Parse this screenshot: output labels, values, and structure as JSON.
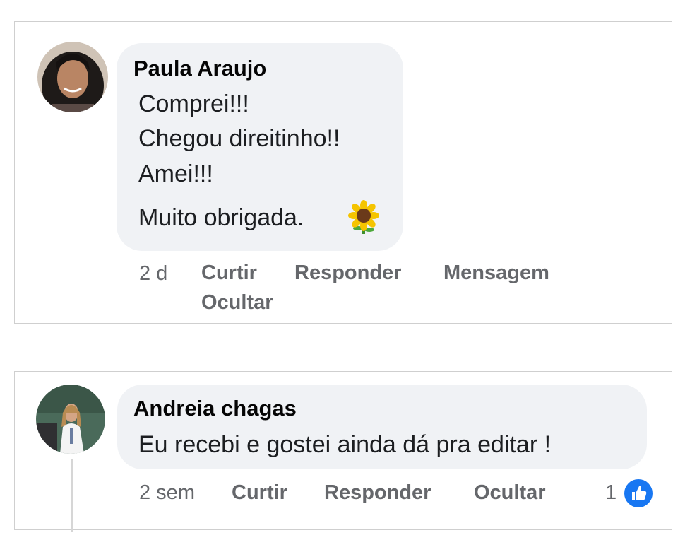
{
  "comments": [
    {
      "author": "Paula Araujo",
      "avatar_icon": "profile-photo-woman",
      "lines": [
        "Comprei!!!",
        "Chegou direitinho!!",
        "Amei!!!",
        "Muito obrigada."
      ],
      "emoji": "sunflower-emoji",
      "time": "2 d",
      "actions": {
        "like": "Curtir",
        "reply": "Responder",
        "message": "Mensagem",
        "hide": "Ocultar"
      }
    },
    {
      "author": "Andreia chagas",
      "avatar_icon": "profile-photo-woman-lab-coat",
      "text": "Eu recebi e gostei ainda dá pra editar !",
      "time": "2 sem",
      "actions": {
        "like": "Curtir",
        "reply": "Responder",
        "hide": "Ocultar"
      },
      "reactions": {
        "count": "1",
        "icon": "thumbs-up-icon",
        "color": "#1877f2"
      }
    }
  ]
}
